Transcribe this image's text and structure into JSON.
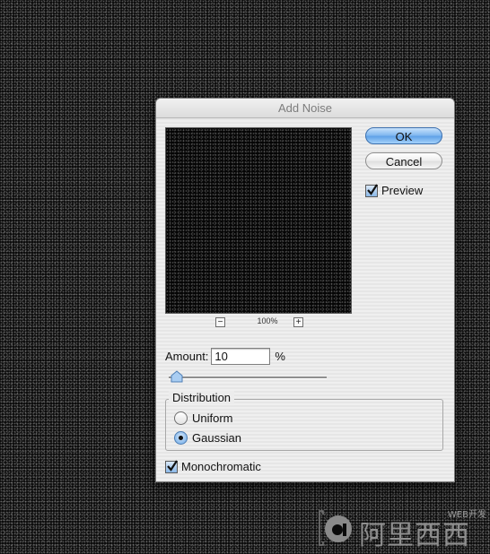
{
  "dialog": {
    "title": "Add Noise",
    "ok_label": "OK",
    "cancel_label": "Cancel",
    "preview_label": "Preview",
    "preview_checked": true,
    "zoom_minus": "−",
    "zoom_plus": "+",
    "zoom_level": "100%",
    "amount_label": "Amount:",
    "amount_value": "10",
    "amount_unit": "%",
    "distribution_label": "Distribution",
    "distribution_options": [
      "Uniform",
      "Gaussian"
    ],
    "distribution_selected": "Gaussian",
    "monochromatic_label": "Monochromatic",
    "monochromatic_checked": true
  },
  "watermark": {
    "small_text": "WEB开发",
    "text": "阿里西西"
  },
  "colors": {
    "ok_button": "#7cb5ef",
    "background": "#0b0b0b",
    "dialog_bg": "#ececec"
  }
}
